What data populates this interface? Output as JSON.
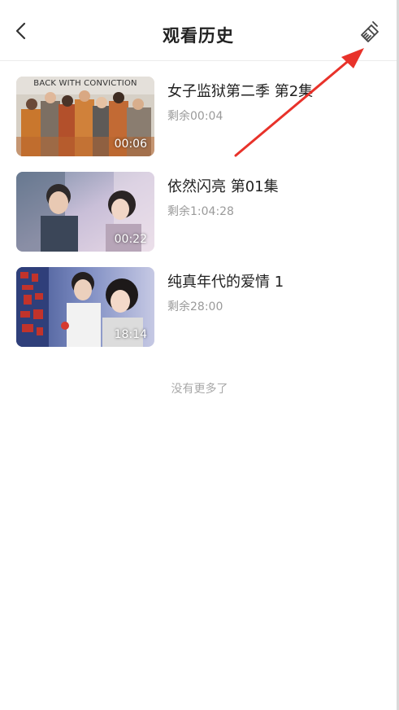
{
  "header": {
    "title": "观看历史",
    "back_icon": "chevron-left-icon",
    "clear_icon": "broom-icon"
  },
  "history": [
    {
      "title": "女子监狱第二季 第2集",
      "remaining": "剩余00:04",
      "duration": "00:06",
      "thumbnail_text": "BACK WITH CONVICTION"
    },
    {
      "title": "依然闪亮 第01集",
      "remaining": "剩余1:04:28",
      "duration": "00:22"
    },
    {
      "title": "纯真年代的爱情 1",
      "remaining": "剩余28:00",
      "duration": "18:14"
    }
  ],
  "footer": {
    "end_text": "没有更多了"
  },
  "colors": {
    "annotation_arrow": "#e8322a",
    "title_text": "#222222",
    "secondary_text": "#9a9a9a"
  }
}
